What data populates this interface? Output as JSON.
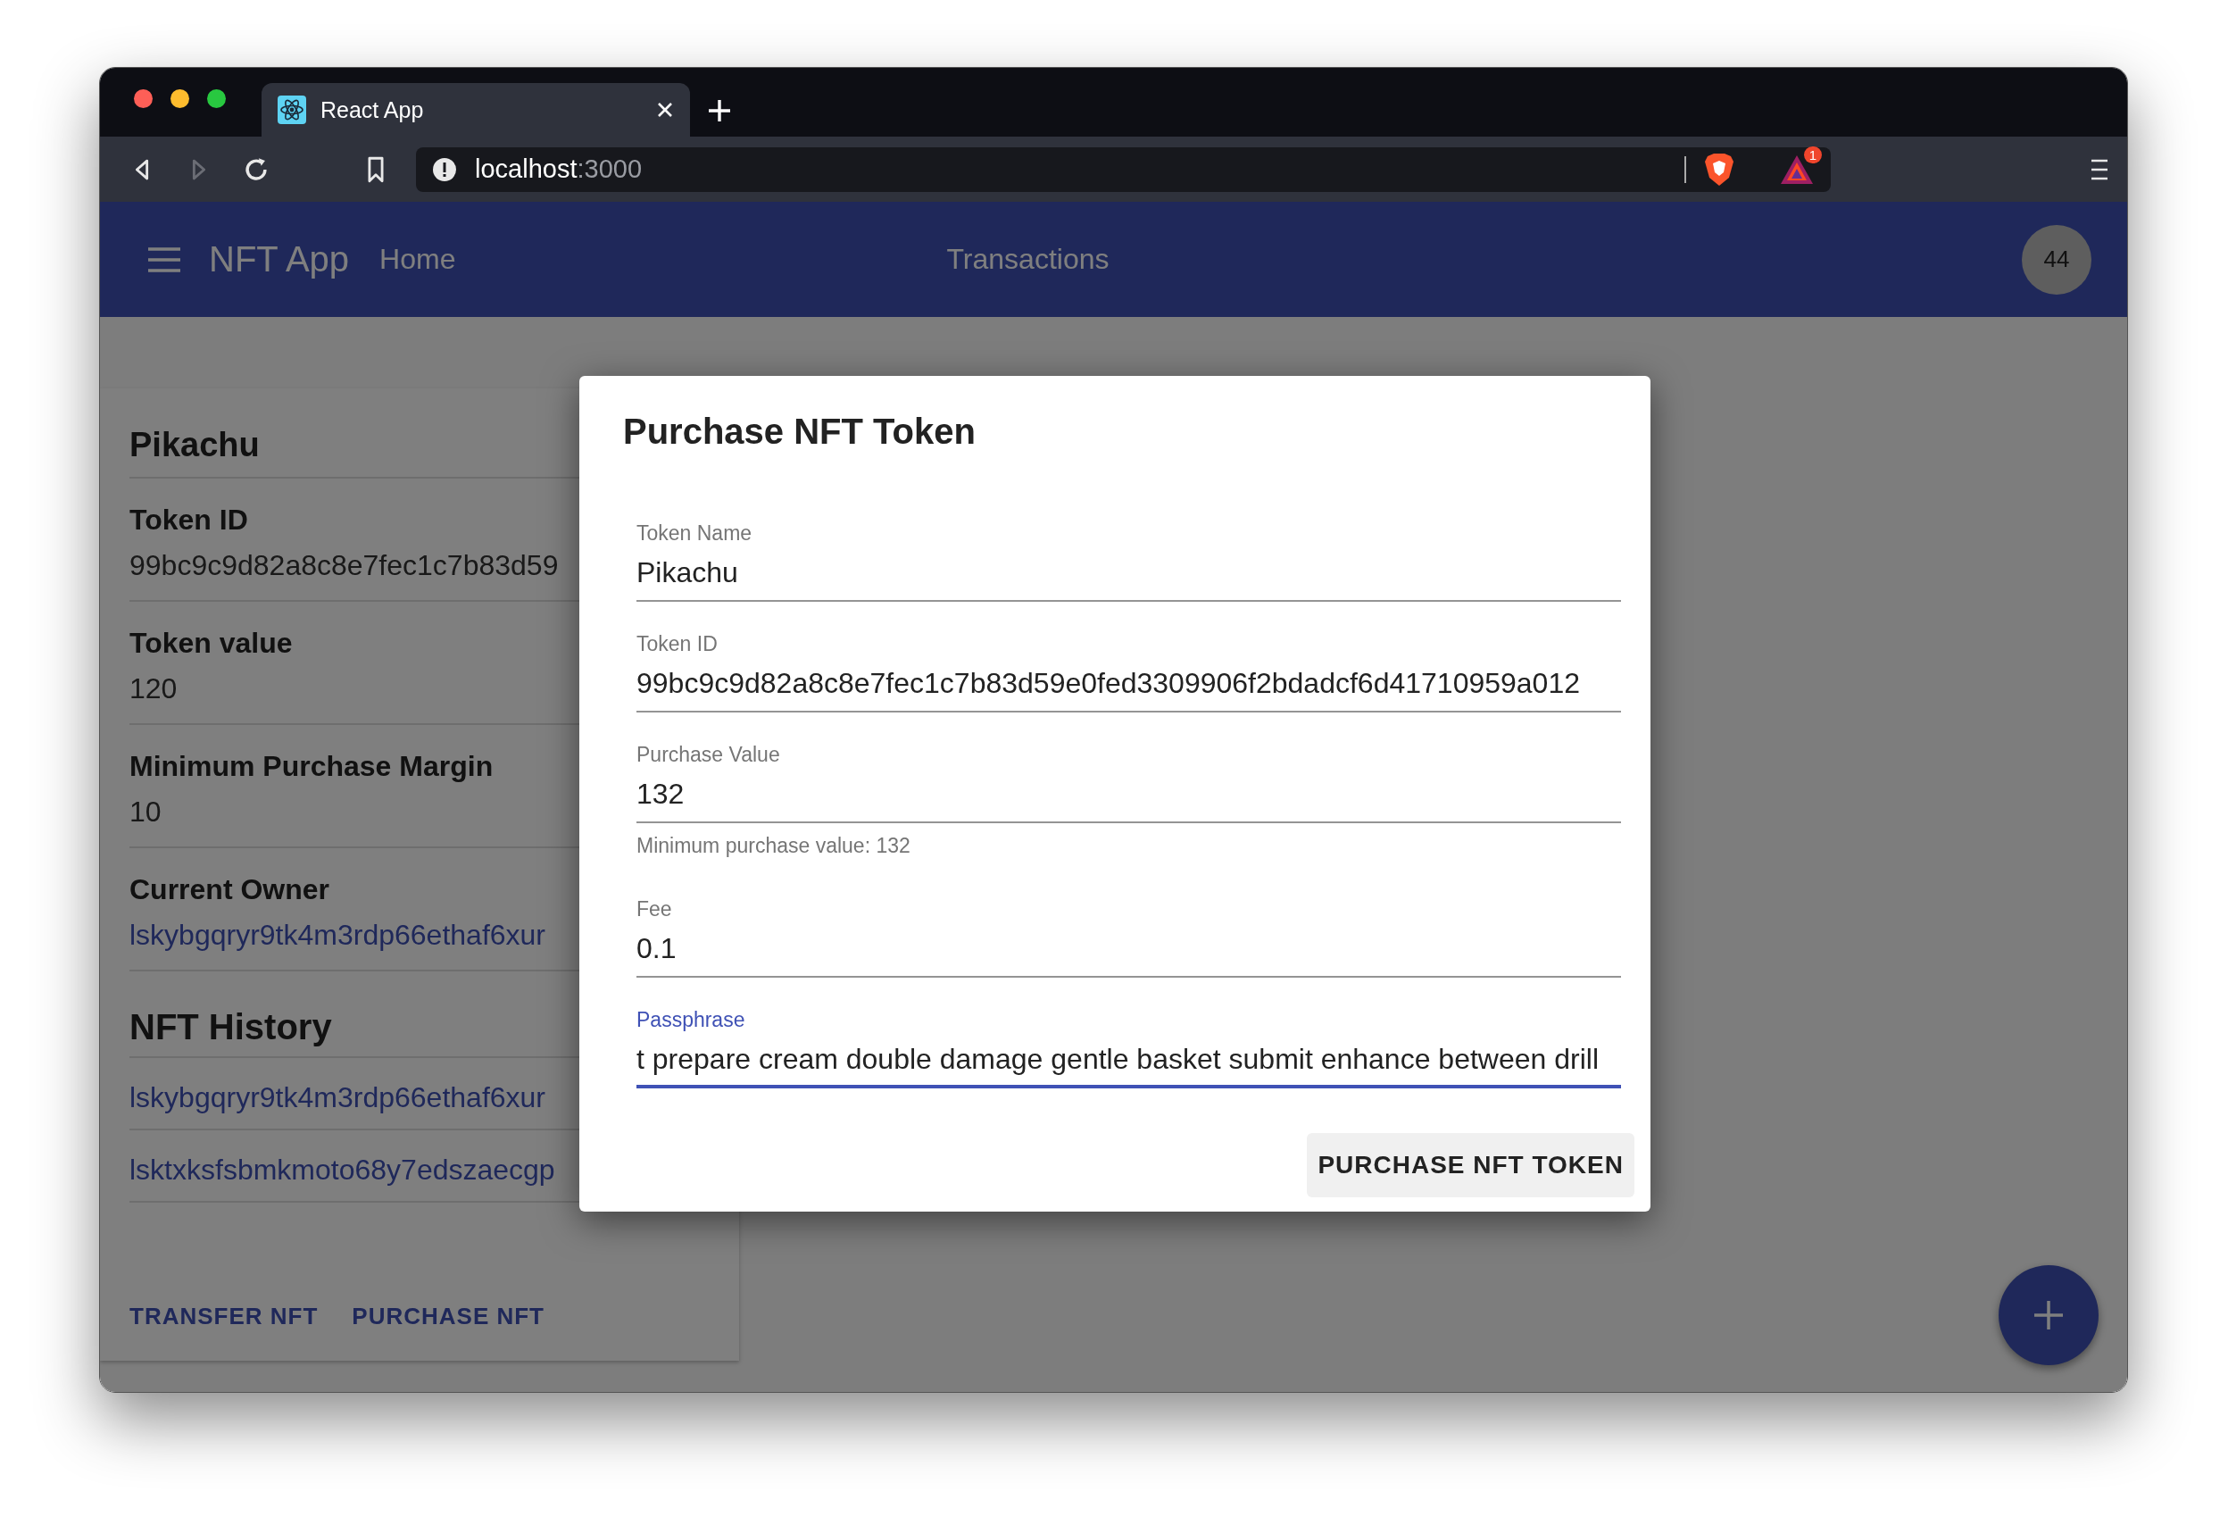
{
  "browser": {
    "tab": {
      "title": "React App",
      "selected": true
    },
    "nav_buttons": [
      {
        "kind": "back",
        "disabled": false
      },
      {
        "kind": "forward",
        "disabled": true
      },
      {
        "kind": "reload",
        "disabled": false
      }
    ],
    "url_host": "localhost",
    "url_port": ":3000",
    "rewards_badge": "1"
  },
  "app_bar": {
    "title": "NFT App",
    "nav": [
      {
        "label": "Home"
      },
      {
        "label": "Transactions"
      }
    ],
    "avatar": "44"
  },
  "card": {
    "title": "Pikachu",
    "fields": [
      {
        "label": "Token ID",
        "value": "99bc9c9d82a8c8e7fec1c7b83d59",
        "kind": "text"
      },
      {
        "label": "Token value",
        "value": "120",
        "kind": "text"
      },
      {
        "label": "Minimum Purchase Margin",
        "value": "10",
        "kind": "text"
      },
      {
        "label": "Current Owner",
        "value": "lskybgqryr9tk4m3rdp66ethaf6xur",
        "kind": "link"
      }
    ],
    "history_title": "NFT History",
    "history": [
      "lskybgqryr9tk4m3rdp66ethaf6xur",
      "lsktxksfsbmkmoto68y7edszaecgp"
    ],
    "actions": [
      "TRANSFER NFT",
      "PURCHASE NFT"
    ]
  },
  "dialog": {
    "title": "Purchase NFT Token",
    "fields": [
      {
        "label": "Token Name",
        "value": "Pikachu",
        "focused": false
      },
      {
        "label": "Token ID",
        "value": "99bc9c9d82a8c8e7fec1c7b83d59e0fed3309906f2bdadcf6d41710959a012",
        "focused": false
      },
      {
        "label": "Purchase Value",
        "value": "132",
        "helper": "Minimum purchase value: 132",
        "focused": false
      },
      {
        "label": "Fee",
        "value": "0.1",
        "focused": false
      },
      {
        "label": "Passphrase",
        "value": "t prepare cream double damage gentle basket submit enhance between drill",
        "focused": true
      }
    ],
    "submit": "PURCHASE NFT TOKEN"
  }
}
